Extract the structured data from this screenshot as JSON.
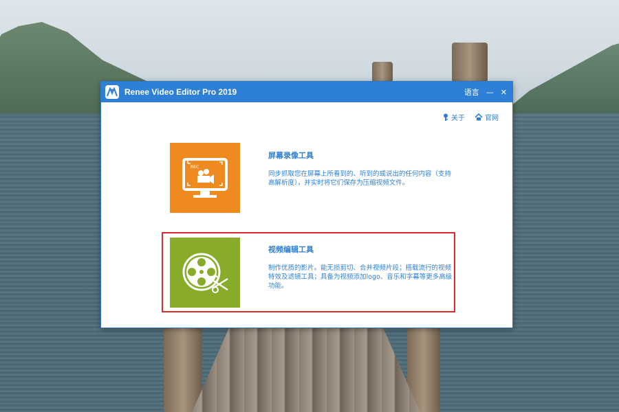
{
  "window": {
    "title": "Renee Video Editor Pro 2019",
    "controls": {
      "language": "语言",
      "minimize": "—",
      "close": "✕"
    }
  },
  "links": {
    "about": "关于",
    "website": "官网"
  },
  "tools": {
    "recorder": {
      "title": "屏幕录像工具",
      "desc": "同步抓取您在屏幕上所看到的、听到的或说出的任何内容（支持高解析度），并实时将它们保存为压缩视频文件。",
      "icon": "screen-recorder-icon",
      "color": "#ee8a1e"
    },
    "editor": {
      "title": "视频编辑工具",
      "desc": "制作优质的影片。能无损剪切、合并视频片段；搭载流行的视频特效及滤镜工具；具备为视频添加logo、音乐和字幕等更多高级功能。",
      "icon": "film-reel-scissors-icon",
      "color": "#88ac2a"
    }
  },
  "colors": {
    "titlebar": "#2d80d6",
    "highlight": "#e0282a"
  }
}
